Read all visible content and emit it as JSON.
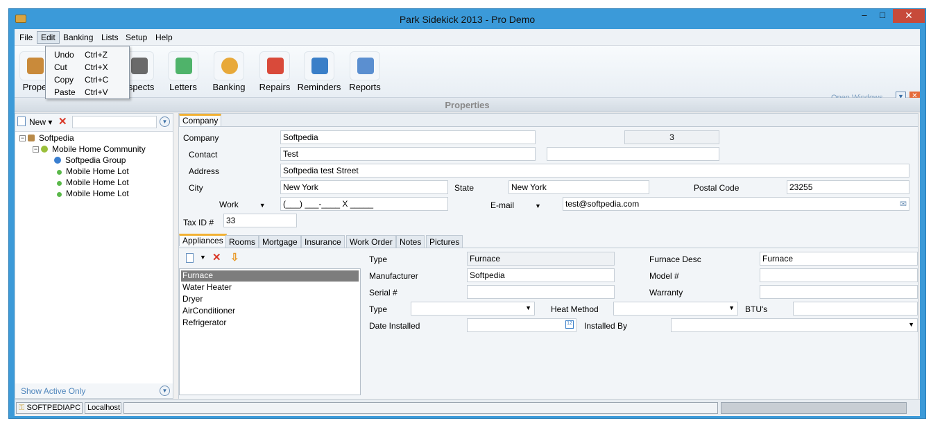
{
  "window": {
    "title": "Park Sidekick 2013 - Pro Demo",
    "min": "–",
    "max": "□",
    "close": "✕"
  },
  "menu": [
    "File",
    "Edit",
    "Banking",
    "Lists",
    "Setup",
    "Help"
  ],
  "edit_menu": [
    {
      "label": "Undo",
      "shortcut": "Ctrl+Z"
    },
    {
      "label": "Cut",
      "shortcut": "Ctrl+X"
    },
    {
      "label": "Copy",
      "shortcut": "Ctrl+C"
    },
    {
      "label": "Paste",
      "shortcut": "Ctrl+V"
    }
  ],
  "toolbar": {
    "properties": "Prope",
    "prospects": "ospects",
    "letters": "Letters",
    "banking": "Banking",
    "repairs": "Repairs",
    "reminders": "Reminders",
    "reports": "Reports",
    "open_windows": "Open Windows"
  },
  "section_title": "Properties",
  "left": {
    "new_label": "New",
    "show_active": "Show Active Only",
    "tree": [
      {
        "label": "Softpedia"
      },
      {
        "label": "Mobile Home Community"
      },
      {
        "label": "Softpedia Group"
      },
      {
        "label": "Mobile Home Lot"
      },
      {
        "label": "Mobile Home Lot"
      },
      {
        "label": "Mobile Home Lot"
      }
    ]
  },
  "company_tab": "Company",
  "company": {
    "company_label": "Company",
    "company_value": "Softpedia",
    "id_value": "3",
    "contact_label": "Contact",
    "contact_value": "Test",
    "contact_extra": "",
    "address_label": "Address",
    "address_value": "Softpedia test Street",
    "city_label": "City",
    "city_value": "New York",
    "state_label": "State",
    "state_value": "New York",
    "postal_label": "Postal Code",
    "postal_value": "23255",
    "work_label": "Work",
    "work_value": "(___) ___-____ X _____",
    "email_label": "E-mail",
    "email_value": "test@softpedia.com",
    "taxid_label": "Tax ID #",
    "taxid_value": "33"
  },
  "sub_tabs": [
    "Appliances",
    "Rooms",
    "Mortgage",
    "Insurance",
    "Work Order",
    "Notes",
    "Pictures"
  ],
  "appliances": [
    "Furnace",
    "Water Heater",
    "Dryer",
    "AirConditioner",
    "Refrigerator"
  ],
  "appliance": {
    "type_label": "Type",
    "type_value": "Furnace",
    "desc_label": "Furnace Desc",
    "desc_value": "Furnace",
    "mfr_label": "Manufacturer",
    "mfr_value": "Softpedia",
    "model_label": "Model #",
    "model_value": "",
    "serial_label": "Serial #",
    "serial_value": "",
    "warranty_label": "Warranty",
    "warranty_value": "",
    "type2_label": "Type",
    "type2_value": "",
    "heat_label": "Heat Method",
    "heat_value": "",
    "btu_label": "BTU's",
    "btu_value": "",
    "date_label": "Date Installed",
    "date_value": "",
    "installedby_label": "Installed By",
    "installedby_value": ""
  },
  "status": {
    "machine": "SOFTPEDIAPC",
    "server": "Localhost"
  }
}
